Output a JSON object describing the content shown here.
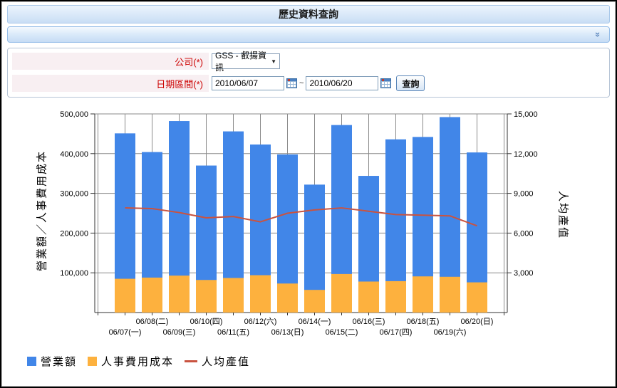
{
  "window": {
    "title": "歷史資料查詢"
  },
  "toolbar": {
    "collapse_icon": "chevron-double-down"
  },
  "form": {
    "company": {
      "label": "公司(*)",
      "value": "GSS - 叡揚資訊"
    },
    "date_range": {
      "label": "日期區間(*)",
      "start": "2010/06/07",
      "separator": "~",
      "end": "2010/06/20",
      "query_label": "查詢"
    }
  },
  "chart_data": {
    "type": "bar",
    "note": "dual-axis combo: bars drawn from baseline (cost bar overlaps revenue bar in front), line on right axis",
    "categories": [
      "06/07(一)",
      "06/08(二)",
      "06/09(三)",
      "06/10(四)",
      "06/11(五)",
      "06/12(六)",
      "06/13(日)",
      "06/14(一)",
      "06/15(二)",
      "06/16(三)",
      "06/17(四)",
      "06/18(五)",
      "06/19(六)",
      "06/20(日)"
    ],
    "series": [
      {
        "name": "營業額",
        "type": "bar",
        "axis": "left",
        "color": "#4186E8",
        "values": [
          451000,
          404000,
          482000,
          370000,
          456000,
          423000,
          398000,
          322000,
          472000,
          344000,
          436000,
          442000,
          492000,
          403000
        ]
      },
      {
        "name": "人事費用成本",
        "type": "bar",
        "axis": "left",
        "color": "#FDB13E",
        "values": [
          85000,
          88000,
          93000,
          82000,
          87000,
          94000,
          73000,
          57000,
          97000,
          78000,
          79000,
          91000,
          90000,
          76000
        ]
      },
      {
        "name": "人均產值",
        "type": "line",
        "axis": "right",
        "color": "#C95340",
        "values": [
          7900,
          7850,
          7550,
          7150,
          7250,
          6850,
          7500,
          7750,
          7900,
          7650,
          7400,
          7350,
          7300,
          6550
        ]
      }
    ],
    "left_axis": {
      "title": "營業額／人事費用成本",
      "max": 500000,
      "ticks": [
        "100,000",
        "200,000",
        "300,000",
        "400,000",
        "500,000"
      ]
    },
    "right_axis": {
      "title": "人均產值",
      "max": 15000,
      "ticks": [
        "3,000",
        "6,000",
        "9,000",
        "12,000",
        "15,000"
      ]
    },
    "grid": "on",
    "legend_position": "bottom-left"
  }
}
